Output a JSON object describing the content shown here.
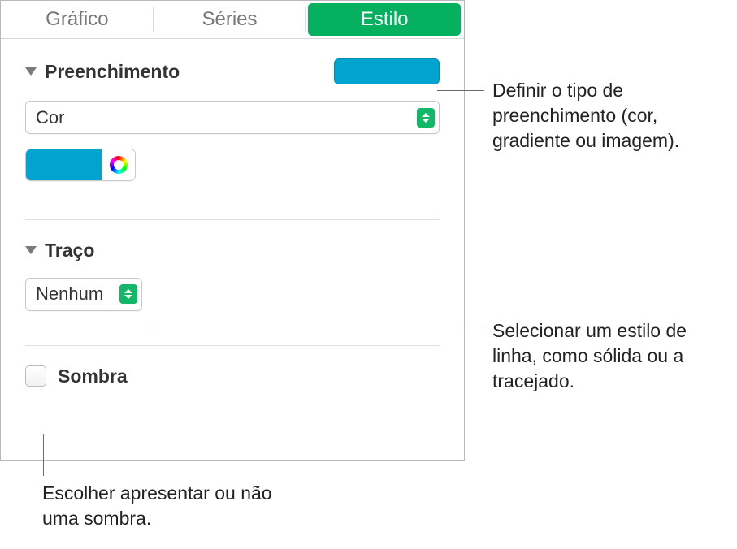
{
  "tabs": {
    "chart": "Gráfico",
    "series": "Séries",
    "style": "Estilo"
  },
  "fill": {
    "title": "Preenchimento",
    "type_select": "Cor",
    "swatch_color": "#00a4cf"
  },
  "stroke": {
    "title": "Traço",
    "select_value": "Nenhum"
  },
  "shadow": {
    "label": "Sombra"
  },
  "callouts": {
    "fill": "Definir o tipo de preenchimento (cor, gradiente ou imagem).",
    "stroke": "Selecionar um estilo de linha, como sólida ou a tracejado.",
    "shadow": "Escolher apresentar ou não uma sombra."
  }
}
